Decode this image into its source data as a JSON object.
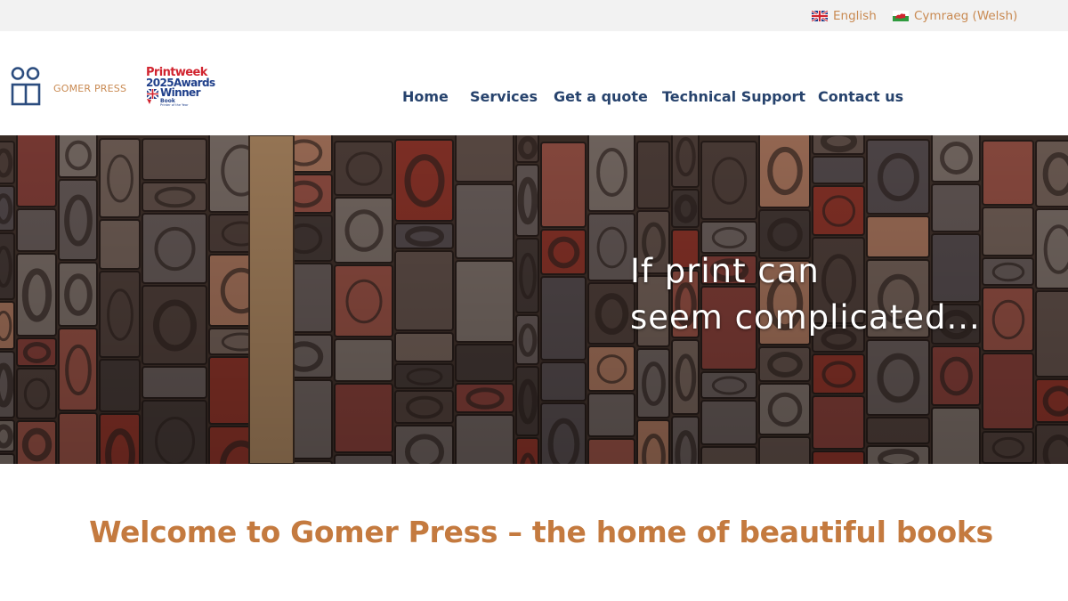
{
  "language_bar": {
    "english": "English",
    "welsh": "Cymraeg (Welsh)"
  },
  "logo": {
    "name": "GOMER PRESS"
  },
  "award": {
    "line1": "Printweek",
    "line2": "2025Awards",
    "line3": "Winner",
    "line4": "Book",
    "line5": "Printer of the Year"
  },
  "nav": {
    "items": [
      "Home",
      "Services",
      "Get a quote",
      "Technical Support",
      "Contact us"
    ]
  },
  "hero": {
    "line1": "If print can",
    "line2": "seem complicated..."
  },
  "welcome": {
    "title": "Welcome to Gomer Press – the home of beautiful books"
  },
  "colors": {
    "accent": "#c47a3f",
    "lang_link": "#c98a52",
    "nav_text": "#27436d",
    "logo_blue": "#2b4c7e",
    "topbar_bg": "#f2f2f2"
  }
}
